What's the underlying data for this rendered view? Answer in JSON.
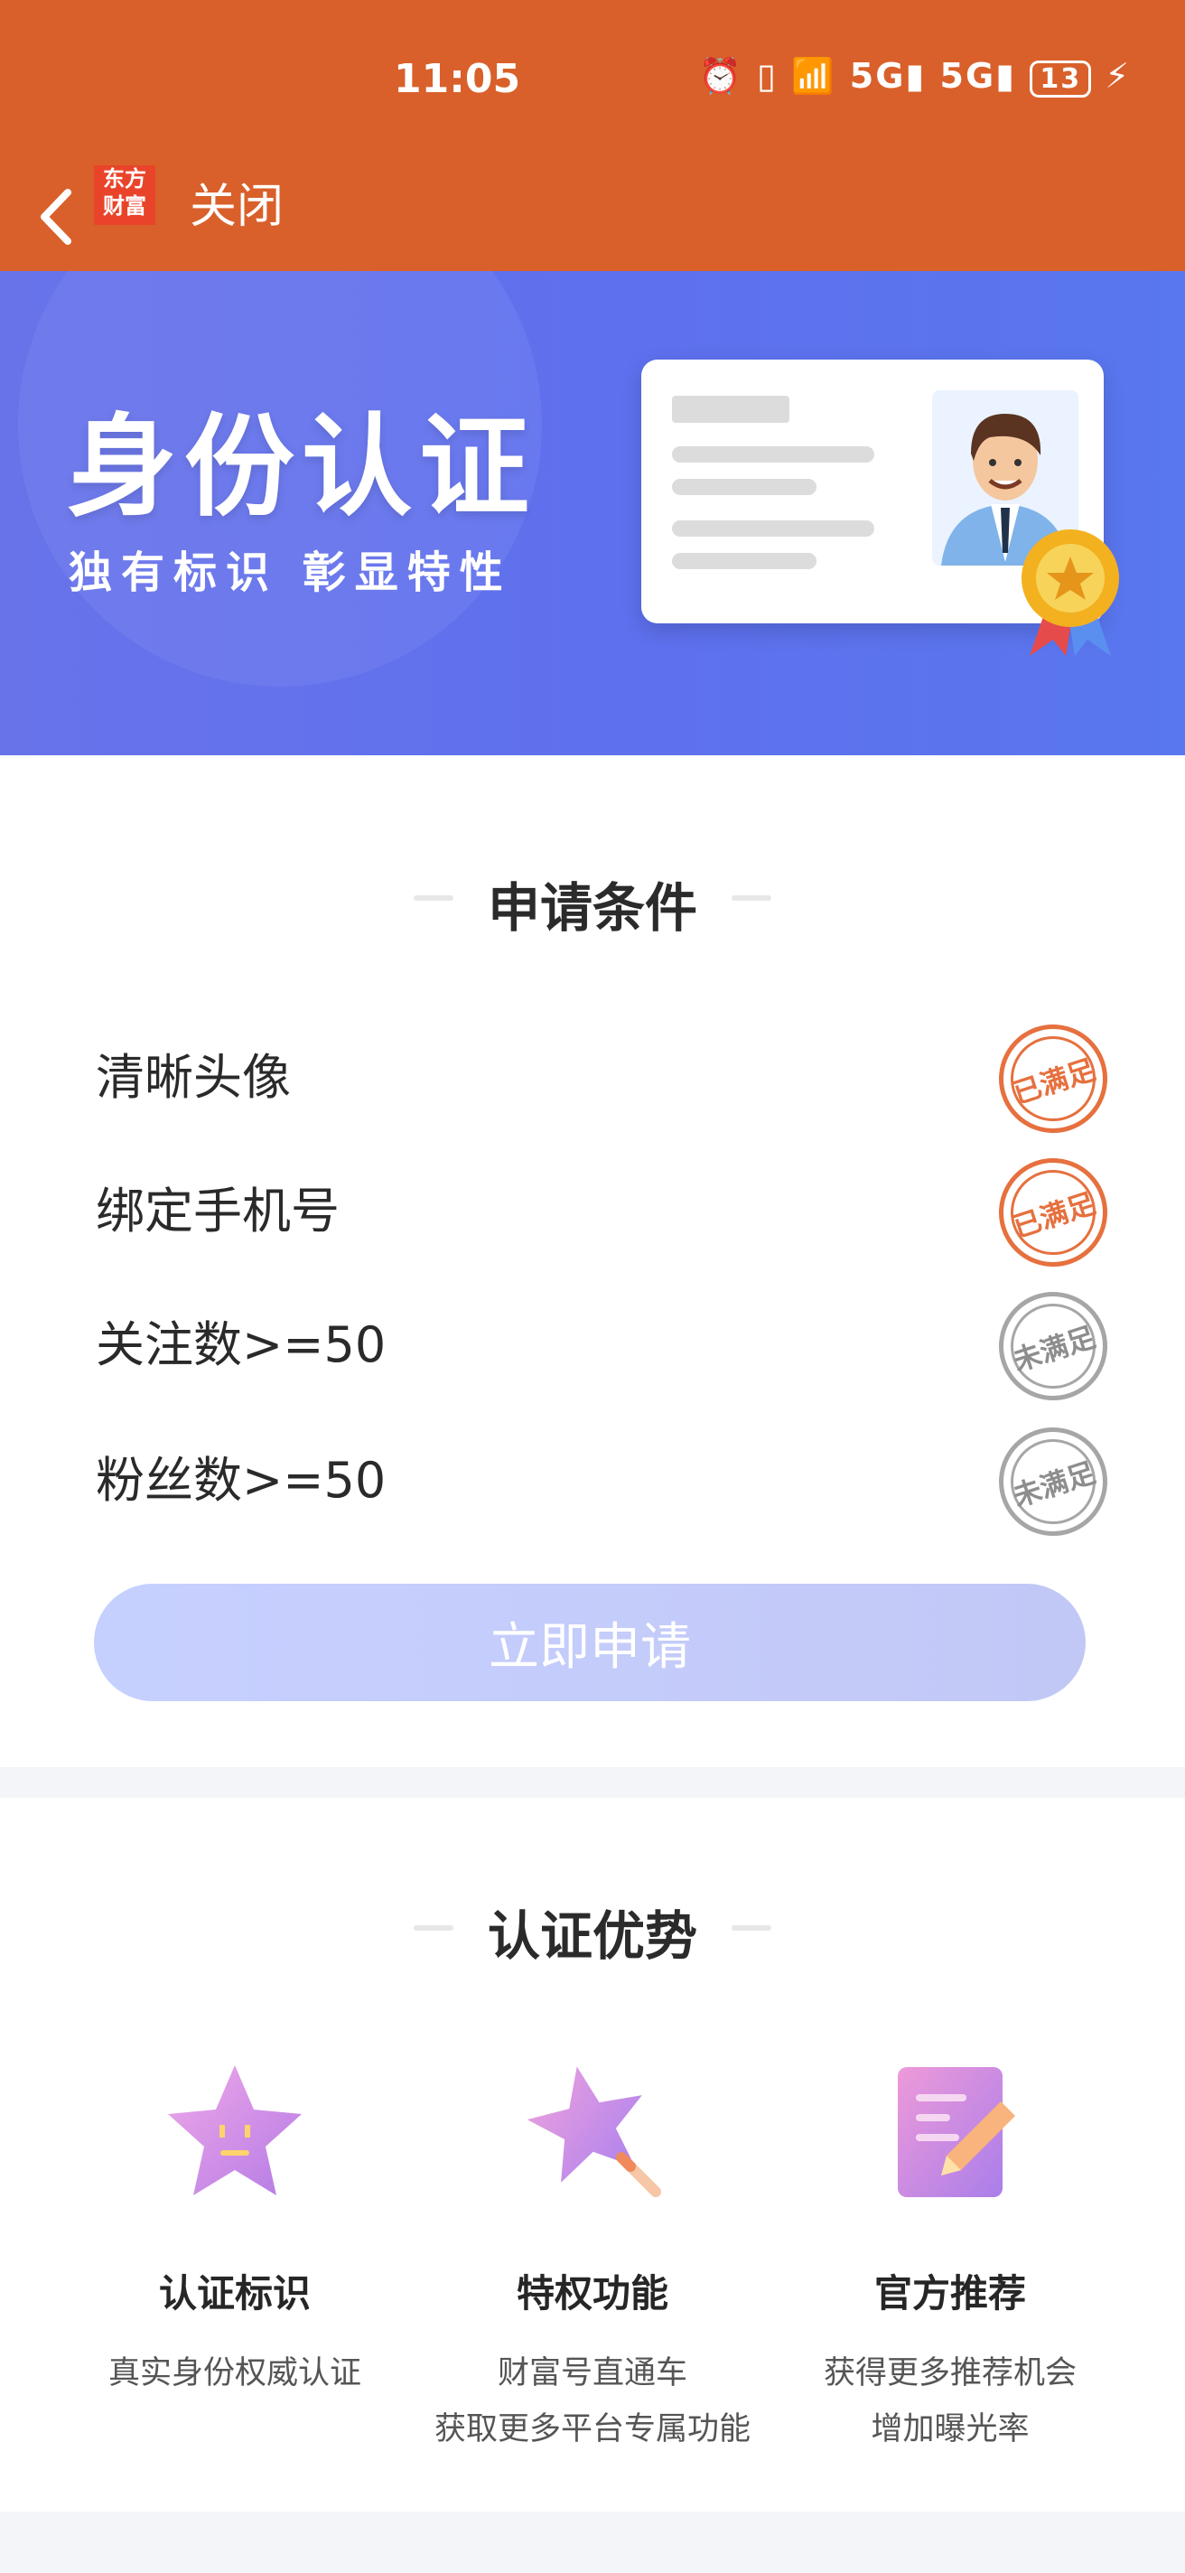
{
  "status_bar": {
    "time": "11:05",
    "battery": "13",
    "icons": [
      "alarm-icon",
      "vibrate-icon",
      "wifi-icon",
      "5g-signal-icon",
      "5g-signal-icon",
      "battery-icon",
      "charging-icon"
    ]
  },
  "nav": {
    "back_icon": "chevron-left-icon",
    "logo": "东方财富",
    "close_label": "关闭"
  },
  "banner": {
    "title": "身份认证",
    "subtitle": "独有标识 彰显特性"
  },
  "conditions": {
    "heading": "申请条件",
    "items": [
      {
        "label": "清晰头像",
        "status": "已满足",
        "met": true
      },
      {
        "label": "绑定手机号",
        "status": "已满足",
        "met": true
      },
      {
        "label": "关注数>=50",
        "status": "未满足",
        "met": false
      },
      {
        "label": "粉丝数>=50",
        "status": "未满足",
        "met": false
      }
    ],
    "apply_button": "立即申请"
  },
  "advantages": {
    "heading": "认证优势",
    "items": [
      {
        "title": "认证标识",
        "desc_line1": "真实身份权威认证",
        "desc_line2": "",
        "icon": "star-face-icon"
      },
      {
        "title": "特权功能",
        "desc_line1": "财富号直通车",
        "desc_line2": "获取更多平台专属功能",
        "icon": "magic-wand-star-icon"
      },
      {
        "title": "官方推荐",
        "desc_line1": "获得更多推荐机会",
        "desc_line2": "增加曝光率",
        "icon": "document-pencil-icon"
      }
    ]
  },
  "colors": {
    "header": "#d9602a",
    "banner": "#6070ee",
    "stamp_met": "#e6703e",
    "stamp_unmet": "#a6a6a6",
    "button": "#c4ccf8"
  }
}
